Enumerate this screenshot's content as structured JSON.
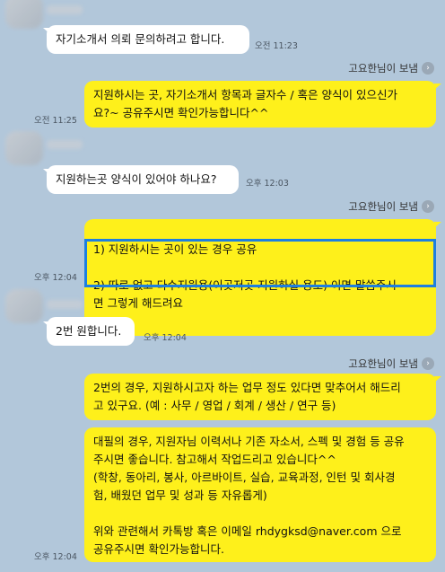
{
  "messages": [
    {
      "id": "m1",
      "text": "자기소개서 의뢰 문의하려고 합니다.",
      "time": "오전 11:23"
    },
    {
      "id": "m2",
      "sender_note": "고요한님이 보냄",
      "text": "지원하시는 곳, 자기소개서 항목과 글자수 / 혹은 양식이 있으신가\n요?~ 공유주시면 확인가능합니다^^",
      "time": "오전 11:25"
    },
    {
      "id": "m3",
      "text": "지원하는곳 양식이 있어야 하나요?",
      "time": "오후 12:03"
    },
    {
      "id": "m4",
      "sender_note": "고요한님이 보냄",
      "line1": "1) 지원하시는 곳이 있는 경우 공유",
      "line2": "2) 따로 없고 다수지원용(이곳저곳 지원하실 용도) 이면 말씀주시\n면 그렇게 해드려요",
      "time": "오후 12:04"
    },
    {
      "id": "m5",
      "text": "2번 원합니다.",
      "time": "오후 12:04"
    },
    {
      "id": "m6",
      "sender_note": "고요한님이 보냄",
      "text": "2번의 경우, 지원하시고자 하는 업무 정도 있다면 맞추어서 해드리\n고 있구요. (예 : 사무 / 영업 / 회계 / 생산 / 연구 등)"
    },
    {
      "id": "m7",
      "text": "대필의 경우, 지원자님 이력서나 기존 자소서, 스펙 및 경험 등 공유\n주시면 좋습니다. 참고해서 작업드리고 있습니다^^\n(학창, 동아리, 봉사, 아르바이트, 실습, 교육과정, 인턴 및 회사경\n험, 배웠던 업무 및 성과 등 자유롭게)\n\n위와 관련해서 카톡방 혹은 이메일 rhdygksd@naver.com 으로\n공유주시면 확인가능합니다.",
      "time": "오후 12:04"
    }
  ],
  "icons": {
    "sender_chevron": "chevron-right-icon"
  },
  "colors": {
    "background": "#b2c7da",
    "outgoing": "#fef01b",
    "incoming": "#ffffff",
    "highlight": "#1e7fe0"
  }
}
